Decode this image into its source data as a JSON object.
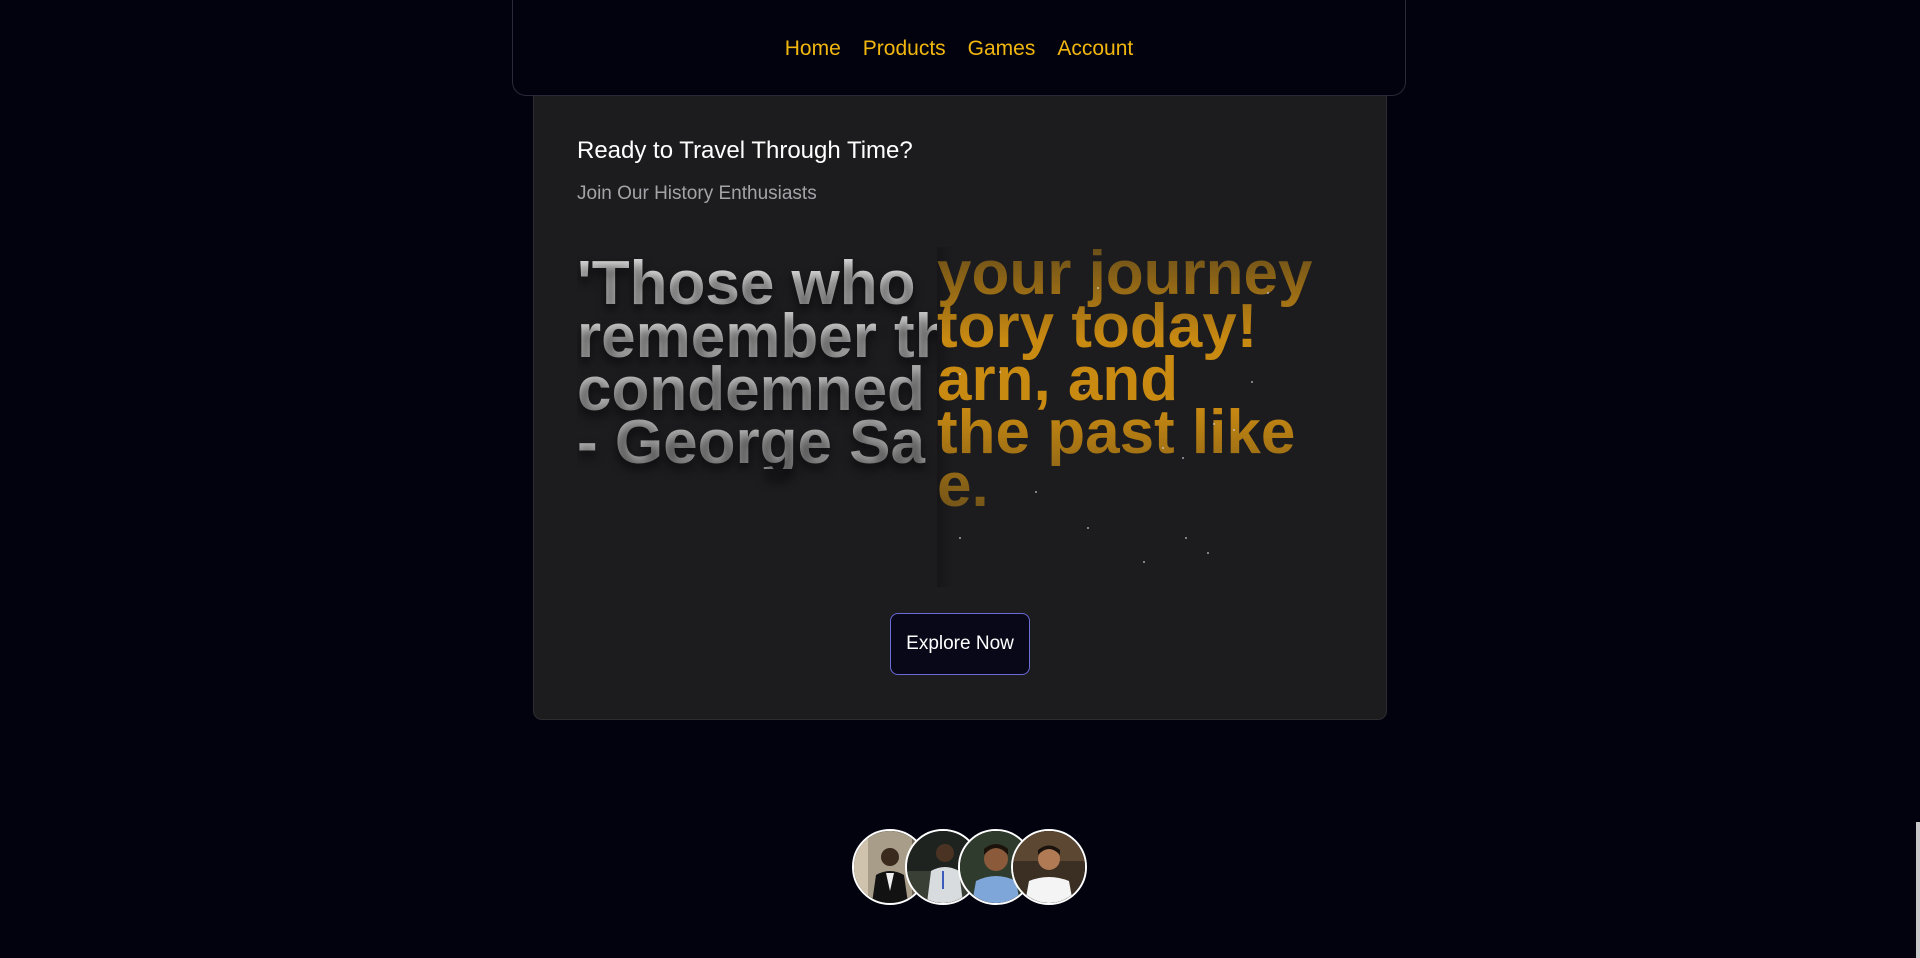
{
  "nav": {
    "items": [
      {
        "label": "Home"
      },
      {
        "label": "Products"
      },
      {
        "label": "Games"
      },
      {
        "label": "Account"
      }
    ]
  },
  "card": {
    "title": "Ready to Travel Through Time?",
    "subtitle": "Join Our History Enthusiasts",
    "quote_lines": [
      "'Those who",
      "remember th",
      "condemned",
      "- George Sa"
    ],
    "cta_lines": [
      "your journey",
      "tory today!",
      "arn, and",
      "the past like",
      "e."
    ],
    "button_label": "Explore Now"
  },
  "team": {
    "avatars": [
      {
        "name": "avatar-1"
      },
      {
        "name": "avatar-2"
      },
      {
        "name": "avatar-3"
      },
      {
        "name": "avatar-4"
      }
    ]
  },
  "colors": {
    "background": "#02020f",
    "nav_link": "#f2b70f",
    "card_bg": "#1c1c1f",
    "accent_gold": "#c98a12",
    "button_border": "#6a6ad8"
  }
}
